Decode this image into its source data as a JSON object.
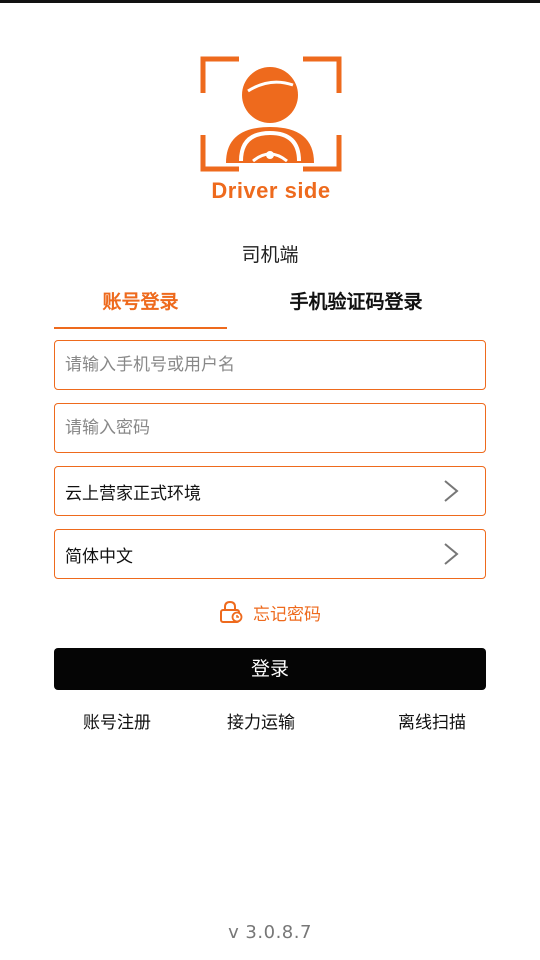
{
  "logo": {
    "text": "Driver side",
    "icon": "driver-steering-wheel-icon",
    "color": "#ee6a1d"
  },
  "app_subtitle": "司机端",
  "tabs": [
    {
      "label": "账号登录",
      "active": true
    },
    {
      "label": "手机验证码登录",
      "active": false
    }
  ],
  "form": {
    "username_placeholder": "请输入手机号或用户名",
    "username_value": "",
    "password_placeholder": "请输入密码",
    "password_value": "",
    "environment": {
      "selected": "云上营家正式环境",
      "icon": "chevron-right-icon"
    },
    "language": {
      "selected": "简体中文",
      "icon": "chevron-right-icon"
    }
  },
  "forgot_password": {
    "label": "忘记密码",
    "icon": "lock-icon"
  },
  "login_button": "登录",
  "bottom_links": {
    "register": "账号注册",
    "relay": "接力运输",
    "offline_scan": "离线扫描"
  },
  "version": "v 3.0.8.7",
  "colors": {
    "accent": "#ee6a1d",
    "button_bg": "#050505",
    "text": "#111111",
    "muted": "#777777"
  }
}
